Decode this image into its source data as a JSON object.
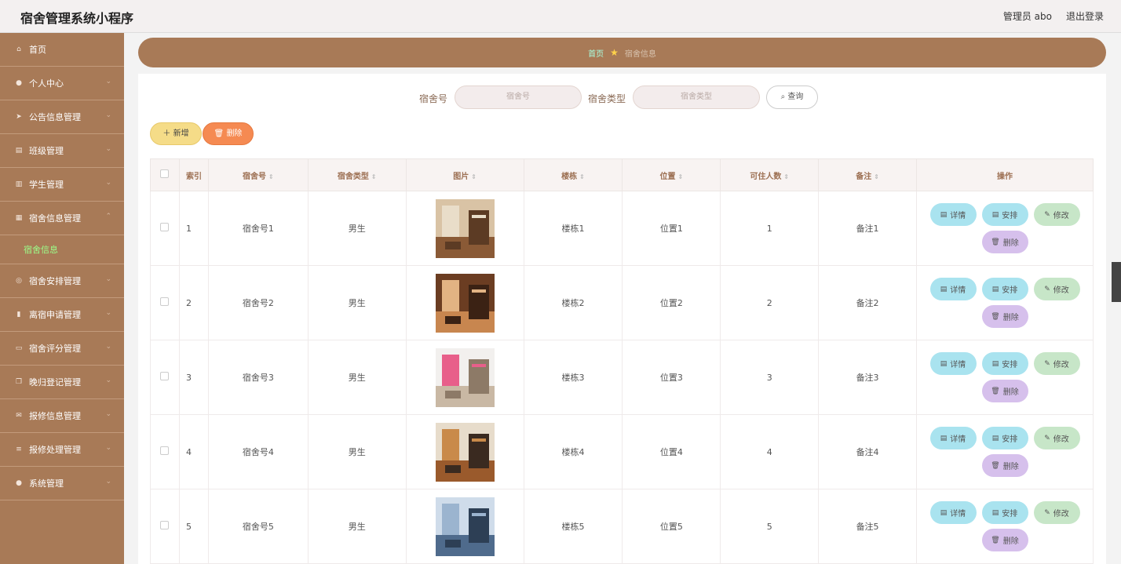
{
  "header": {
    "title": "宿舍管理系统小程序",
    "user": "管理员 abo",
    "logout": "退出登录"
  },
  "sidebar": {
    "items": [
      {
        "label": "首页",
        "icon": "home-icon"
      },
      {
        "label": "个人中心",
        "icon": "user-icon"
      },
      {
        "label": "公告信息管理",
        "icon": "send-icon"
      },
      {
        "label": "班级管理",
        "icon": "menu-icon"
      },
      {
        "label": "学生管理",
        "icon": "chart-icon"
      },
      {
        "label": "宿舍信息管理",
        "icon": "grid-icon"
      },
      {
        "label": "宿舍安排管理",
        "icon": "globe-icon"
      },
      {
        "label": "离宿申请管理",
        "icon": "bars-icon"
      },
      {
        "label": "宿舍评分管理",
        "icon": "comment-icon"
      },
      {
        "label": "晚归登记管理",
        "icon": "copy-icon"
      },
      {
        "label": "报修信息管理",
        "icon": "mail-icon"
      },
      {
        "label": "报修处理管理",
        "icon": "list-icon"
      },
      {
        "label": "系统管理",
        "icon": "user-icon"
      }
    ],
    "sub_item": "宿舍信息"
  },
  "breadcrumb": {
    "home": "首页",
    "current": "宿舍信息"
  },
  "search": {
    "label1": "宿舍号",
    "placeholder1": "宿舍号",
    "label2": "宿舍类型",
    "placeholder2": "宿舍类型",
    "button": "查询"
  },
  "toolbar": {
    "add": "新增",
    "delete": "删除"
  },
  "table": {
    "headers": {
      "index": "索引",
      "room_no": "宿舍号",
      "room_type": "宿舍类型",
      "image": "图片",
      "building": "楼栋",
      "location": "位置",
      "capacity": "可住人数",
      "remark": "备注",
      "actions": "操作"
    },
    "rows": [
      {
        "index": "1",
        "room_no": "宿舍号1",
        "room_type": "男生",
        "building": "楼栋1",
        "location": "位置1",
        "capacity": "1",
        "remark": "备注1"
      },
      {
        "index": "2",
        "room_no": "宿舍号2",
        "room_type": "男生",
        "building": "楼栋2",
        "location": "位置2",
        "capacity": "2",
        "remark": "备注2"
      },
      {
        "index": "3",
        "room_no": "宿舍号3",
        "room_type": "男生",
        "building": "楼栋3",
        "location": "位置3",
        "capacity": "3",
        "remark": "备注3"
      },
      {
        "index": "4",
        "room_no": "宿舍号4",
        "room_type": "男生",
        "building": "楼栋4",
        "location": "位置4",
        "capacity": "4",
        "remark": "备注4"
      },
      {
        "index": "5",
        "room_no": "宿舍号5",
        "room_type": "男生",
        "building": "楼栋5",
        "location": "位置5",
        "capacity": "5",
        "remark": "备注5"
      }
    ],
    "actions": {
      "detail": "详情",
      "arrange": "安排",
      "edit": "修改",
      "delete": "删除"
    }
  },
  "colors": {
    "sidebar": "#a87a57",
    "accent_green": "#9bff8a",
    "add_button": "#f5dc88",
    "delete_button": "#f58a52"
  }
}
